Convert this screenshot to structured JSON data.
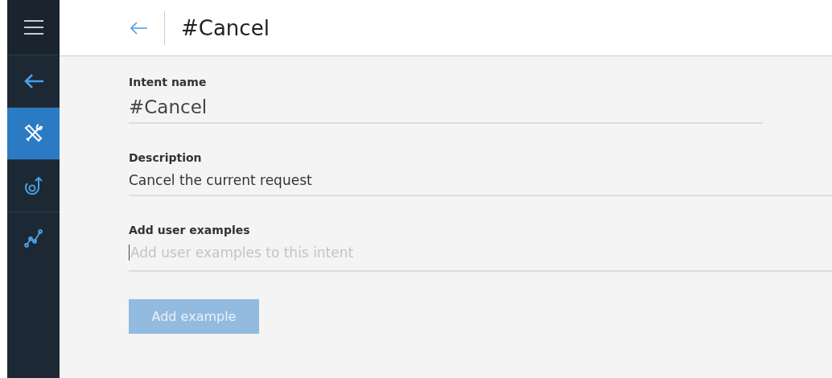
{
  "sidebar": {
    "items": [
      {
        "kind": "menu",
        "selected": false
      },
      {
        "kind": "back",
        "selected": false
      },
      {
        "kind": "tools",
        "selected": true
      },
      {
        "kind": "flow",
        "selected": false
      },
      {
        "kind": "chart",
        "selected": false
      }
    ]
  },
  "header": {
    "title": "#Cancel"
  },
  "fields": [
    {
      "label": "Intent name",
      "value": "#Cancel",
      "kind": "large"
    },
    {
      "label": "Description",
      "value": "Cancel the current request",
      "kind": "wide"
    },
    {
      "label": "Add user examples",
      "placeholder": "Add user examples to this intent",
      "kind": "wide"
    }
  ],
  "button": {
    "label": "Add example",
    "disabled": true
  }
}
